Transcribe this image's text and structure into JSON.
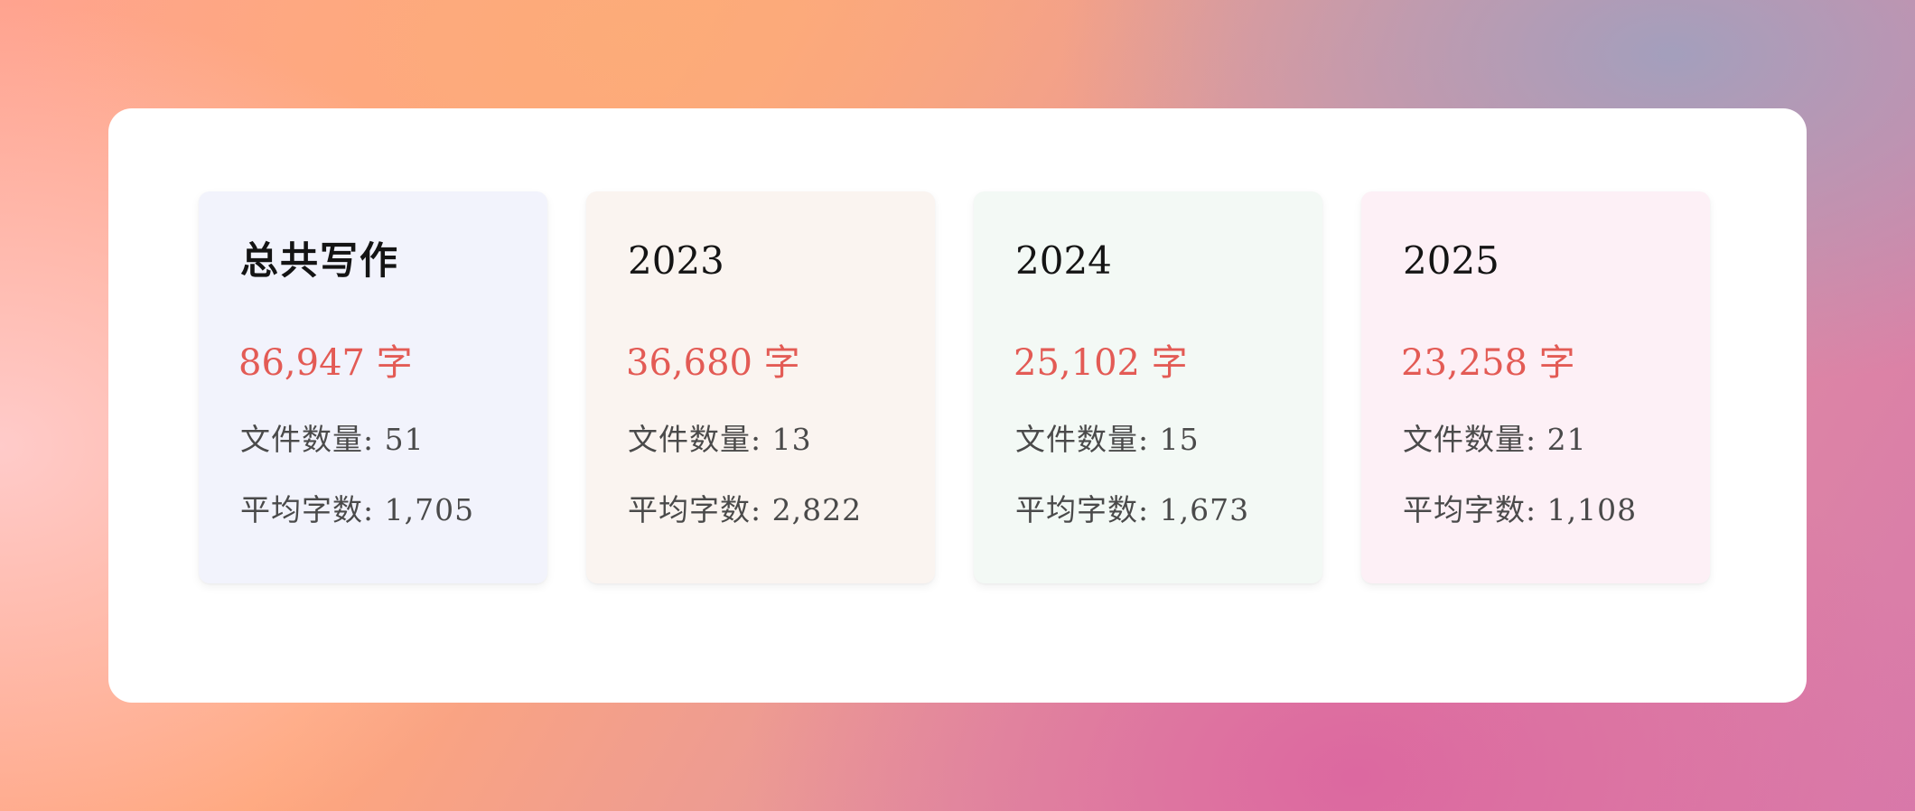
{
  "cards": [
    {
      "title": "总共写作",
      "total": "86,947 字",
      "files": "文件数量: 51",
      "average": "平均字数: 1,705",
      "bg": "#f2f3fc"
    },
    {
      "title": "2023",
      "total": "36,680 字",
      "files": "文件数量: 13",
      "average": "平均字数: 2,822",
      "bg": "#faf4f0"
    },
    {
      "title": "2024",
      "total": "25,102 字",
      "files": "文件数量: 15",
      "average": "平均字数: 1,673",
      "bg": "#f3f9f5"
    },
    {
      "title": "2025",
      "total": "23,258 字",
      "files": "文件数量: 21",
      "average": "平均字数: 1,108",
      "bg": "#fdf0f6"
    }
  ],
  "colors": {
    "accent": "#e35b55",
    "title": "#141414",
    "stat": "#4a4a4a",
    "panel": "#ffffff"
  }
}
